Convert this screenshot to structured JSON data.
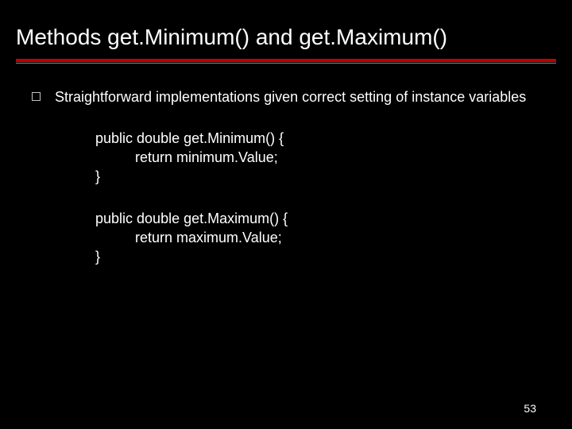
{
  "title": "Methods get.Minimum() and get.Maximum()",
  "bullet": "Straightforward implementations given correct setting of instance variables",
  "code1_l1": "public double get.Minimum() {",
  "code1_l2": "          return minimum.Value;",
  "code1_l3": "}",
  "code2_l1": "public double get.Maximum() {",
  "code2_l2": "          return maximum.Value;",
  "code2_l3": "}",
  "page_number": "53"
}
